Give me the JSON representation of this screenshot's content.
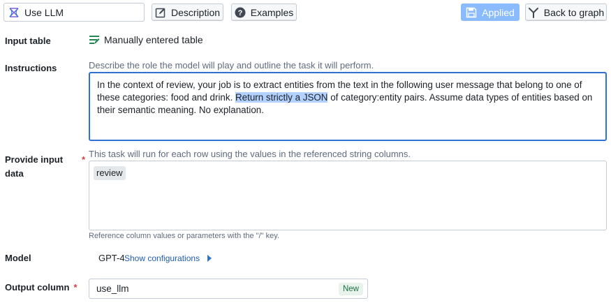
{
  "toolbar": {
    "name_value": "Use LLM",
    "description_label": "Description",
    "examples_label": "Examples",
    "applied_label": "Applied",
    "back_label": "Back to graph"
  },
  "input_table": {
    "label": "Input table",
    "value": "Manually entered table"
  },
  "instructions": {
    "label": "Instructions",
    "hint": "Describe the role the model will play and outline the task it will perform.",
    "text_before": "In the context of review, your job is to extract entities from the text in the following user message that belong to one of these categories: food and drink. ",
    "text_selected": "Return strictly a JSON",
    "text_after": " of category:entity pairs. Assume data types of entities based on their semantic meaning. No explanation."
  },
  "input_data": {
    "label_line1": "Provide input",
    "label_line2": "data",
    "required_mark": "*",
    "hint": "This task will run for each row using the values in the referenced string columns.",
    "tag": "review",
    "footer_hint": "Reference column values or parameters with the \"/\" key."
  },
  "model": {
    "label": "Model",
    "value": "GPT-4",
    "config_link": "Show configurations"
  },
  "output": {
    "label": "Output column",
    "required_mark": "*",
    "value": "use_llm",
    "badge": "New"
  },
  "colors": {
    "primary": "#2d72d2",
    "applied_bg": "#8abbff",
    "required": "#cd4246",
    "success": "#1c6e42"
  }
}
